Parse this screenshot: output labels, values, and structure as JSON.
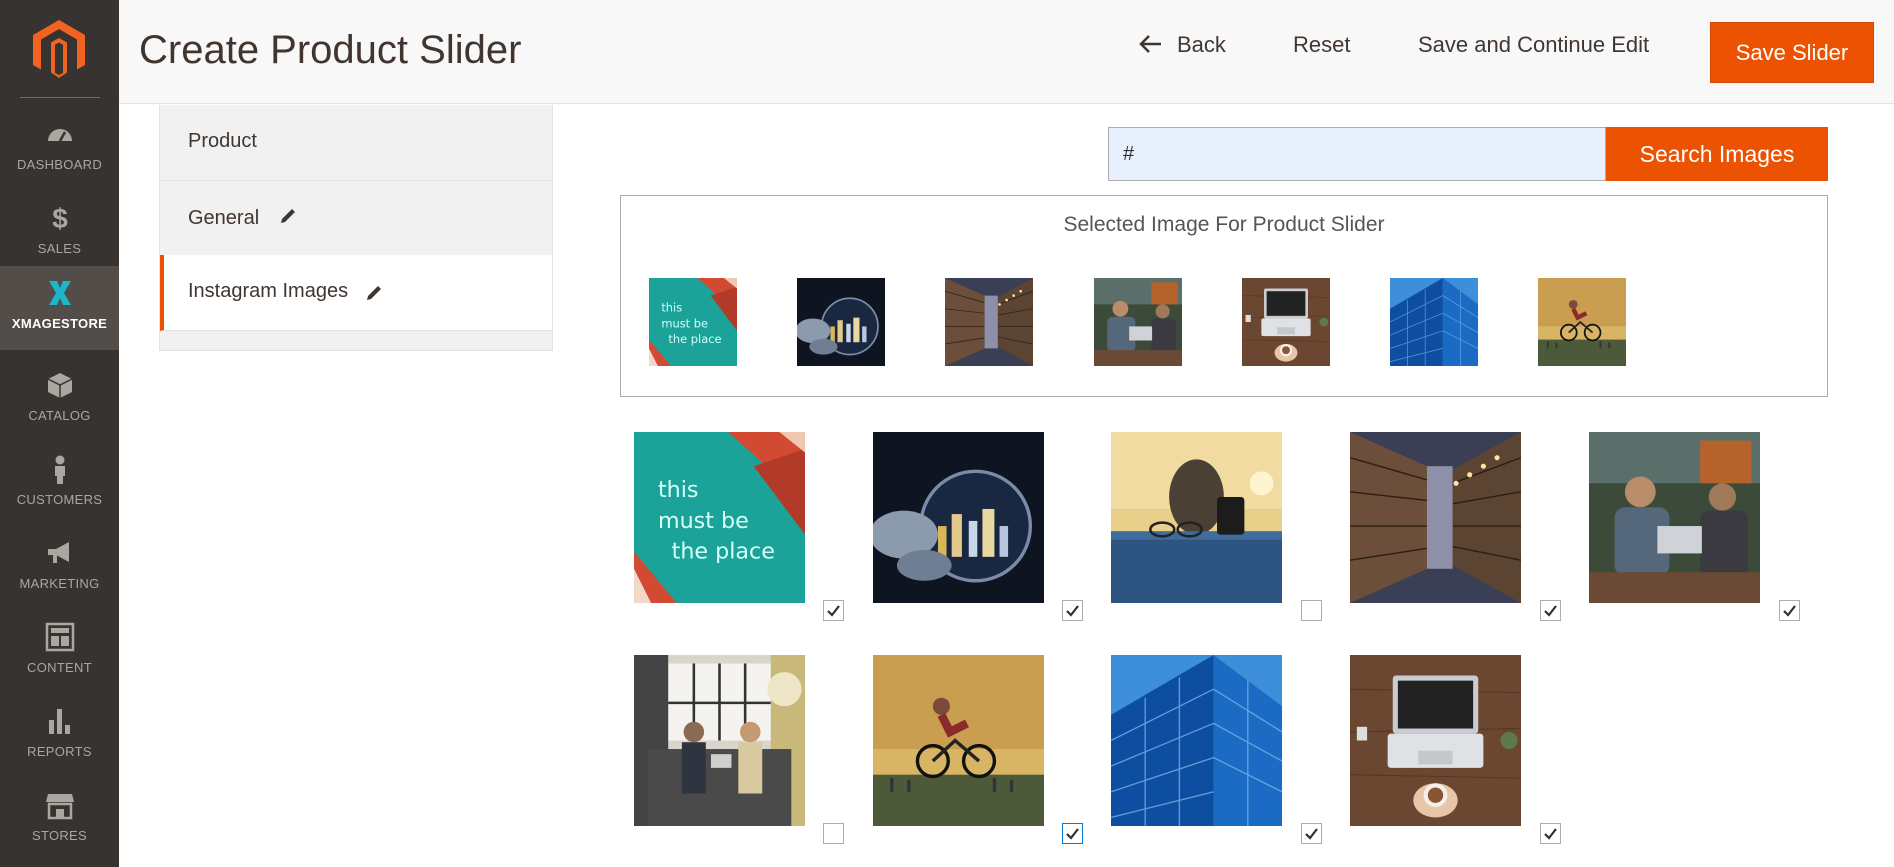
{
  "sidebar": {
    "items": [
      {
        "label": "DASHBOARD",
        "icon": "dashboard-icon"
      },
      {
        "label": "SALES",
        "icon": "dollar-icon"
      },
      {
        "label": "XMAGESTORE",
        "icon": "xmagestore-icon",
        "active": true
      },
      {
        "label": "CATALOG",
        "icon": "box-icon"
      },
      {
        "label": "CUSTOMERS",
        "icon": "person-icon"
      },
      {
        "label": "MARKETING",
        "icon": "megaphone-icon"
      },
      {
        "label": "CONTENT",
        "icon": "layout-icon"
      },
      {
        "label": "REPORTS",
        "icon": "bar-chart-icon"
      },
      {
        "label": "STORES",
        "icon": "storefront-icon"
      }
    ]
  },
  "header": {
    "title": "Create Product Slider",
    "back_label": "Back",
    "reset_label": "Reset",
    "save_continue_label": "Save and Continue Edit",
    "save_label": "Save Slider"
  },
  "tabs": [
    {
      "label": "Product",
      "edit": false
    },
    {
      "label": "General",
      "edit": true
    },
    {
      "label": "Instagram Images",
      "edit": true,
      "active": true
    }
  ],
  "search": {
    "value": "#",
    "button_label": "Search Images"
  },
  "selected": {
    "title": "Selected Image For Product Slider",
    "images": [
      "neon-sign",
      "magnifier-city",
      "library-shelves",
      "people-laptop-cafe",
      "laptop-wood-desk",
      "glass-building",
      "bmx-rider"
    ]
  },
  "grid": [
    {
      "image": "neon-sign",
      "checked": true
    },
    {
      "image": "magnifier-city",
      "checked": true
    },
    {
      "image": "glasses-lens-sunset",
      "checked": false
    },
    {
      "image": "library-shelves",
      "checked": true
    },
    {
      "image": "people-laptop-cafe",
      "checked": true
    },
    {
      "image": "meeting-booth",
      "checked": false
    },
    {
      "image": "bmx-rider",
      "checked": true
    },
    {
      "image": "glass-building",
      "checked": true
    },
    {
      "image": "laptop-wood-desk",
      "checked": true
    }
  ],
  "image_text": {
    "neon_sign": [
      "this",
      "must be",
      "the place"
    ]
  },
  "colors": {
    "accent": "#eb5202",
    "sidebar": "#373330",
    "sidebar_active": "#524d49"
  }
}
